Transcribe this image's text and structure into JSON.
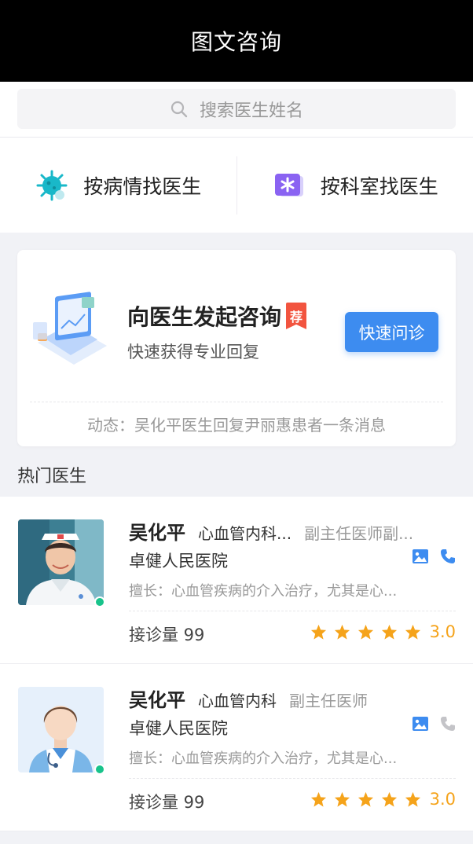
{
  "header": {
    "title": "图文咨询"
  },
  "search": {
    "placeholder": "搜索医生姓名"
  },
  "entries": [
    {
      "label": "按病情找医生",
      "icon": "virus-icon"
    },
    {
      "label": "按科室找医生",
      "icon": "department-icon"
    }
  ],
  "consult": {
    "title": "向医生发起咨询",
    "badge": "荐",
    "subtitle": "快速获得专业回复",
    "button": "快速问诊",
    "dynamic": "动态：吴化平医生回复尹丽惠患者一条消息"
  },
  "hot_section": {
    "title": "热门医生"
  },
  "doctors": [
    {
      "name": "吴化平",
      "dept": "心血管内科...",
      "rank": "副主任医师副...",
      "hospital": "卓健人民医院",
      "specialty": "擅长：心血管疾病的介入治疗，尤其是心...",
      "visits": "接诊量 99",
      "score": "3.0",
      "stars": 5,
      "online": true,
      "phone_active": true
    },
    {
      "name": "吴化平",
      "dept": "心血管内科",
      "rank": "副主任医师",
      "hospital": "卓健人民医院",
      "specialty": "擅长：心血管疾病的介入治疗，尤其是心...",
      "visits": "接诊量 99",
      "score": "3.0",
      "stars": 5,
      "online": true,
      "phone_active": false
    }
  ],
  "colors": {
    "primary": "#3d8cf0",
    "star": "#f5a31a",
    "online": "#18c38b",
    "badge": "#f2543f"
  }
}
